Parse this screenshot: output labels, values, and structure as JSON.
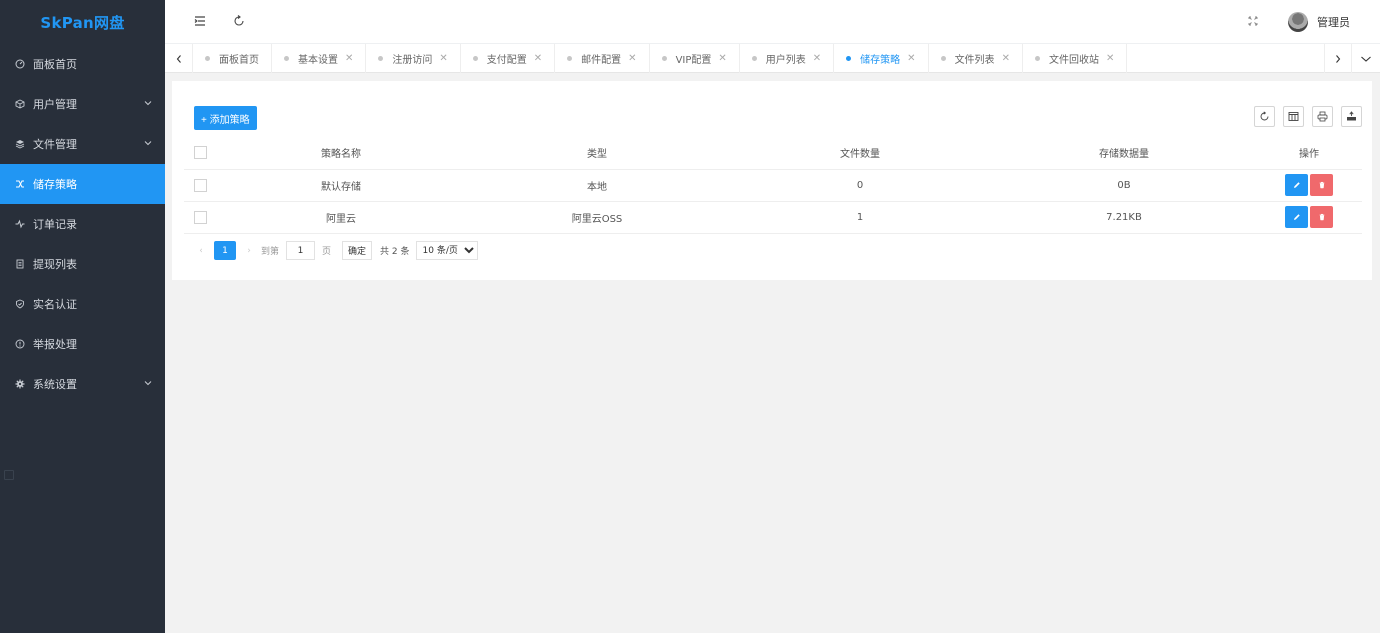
{
  "app": {
    "logo": "SkPan网盘"
  },
  "sidebar": {
    "items": [
      {
        "label": "面板首页",
        "icon": "dashboard-icon",
        "expandable": false
      },
      {
        "label": "用户管理",
        "icon": "cube-icon",
        "expandable": true
      },
      {
        "label": "文件管理",
        "icon": "layers-icon",
        "expandable": true
      },
      {
        "label": "储存策略",
        "icon": "shuffle-icon",
        "expandable": false,
        "active": true
      },
      {
        "label": "订单记录",
        "icon": "activity-icon",
        "expandable": false
      },
      {
        "label": "提现列表",
        "icon": "document-icon",
        "expandable": false
      },
      {
        "label": "实名认证",
        "icon": "shield-check-icon",
        "expandable": false
      },
      {
        "label": "举报处理",
        "icon": "alert-circle-icon",
        "expandable": false
      },
      {
        "label": "系统设置",
        "icon": "gear-icon",
        "expandable": true
      }
    ]
  },
  "header": {
    "icons": [
      "menu-collapse-icon",
      "refresh-icon",
      "fullscreen-icon"
    ],
    "user_name": "管理员"
  },
  "tabs": [
    {
      "label": "面板首页",
      "closable": false
    },
    {
      "label": "基本设置",
      "closable": true
    },
    {
      "label": "注册访问",
      "closable": true
    },
    {
      "label": "支付配置",
      "closable": true
    },
    {
      "label": "邮件配置",
      "closable": true
    },
    {
      "label": "VIP配置",
      "closable": true
    },
    {
      "label": "用户列表",
      "closable": true
    },
    {
      "label": "储存策略",
      "closable": true,
      "active": true
    },
    {
      "label": "文件列表",
      "closable": true
    },
    {
      "label": "文件回收站",
      "closable": true
    }
  ],
  "toolbar": {
    "add_label": "+ 添加策略",
    "tool_icons": [
      "refresh-icon",
      "columns-icon",
      "print-icon",
      "export-icon"
    ]
  },
  "table": {
    "columns": [
      "策略名称",
      "类型",
      "文件数量",
      "存储数据量",
      "操作"
    ],
    "rows": [
      {
        "name": "默认存储",
        "type": "本地",
        "count": "0",
        "size": "0B"
      },
      {
        "name": "阿里云",
        "type": "阿里云OSS",
        "count": "1",
        "size": "7.21KB"
      }
    ]
  },
  "pagination": {
    "current": "1",
    "goto_label": "到第",
    "goto_value": "1",
    "page_label": "页",
    "confirm_label": "确定",
    "total_label": "共 2 条",
    "page_size": "10 条/页"
  },
  "colors": {
    "primary": "#2196f3",
    "danger": "#f0696c",
    "sidebar_bg": "#282f3a"
  }
}
